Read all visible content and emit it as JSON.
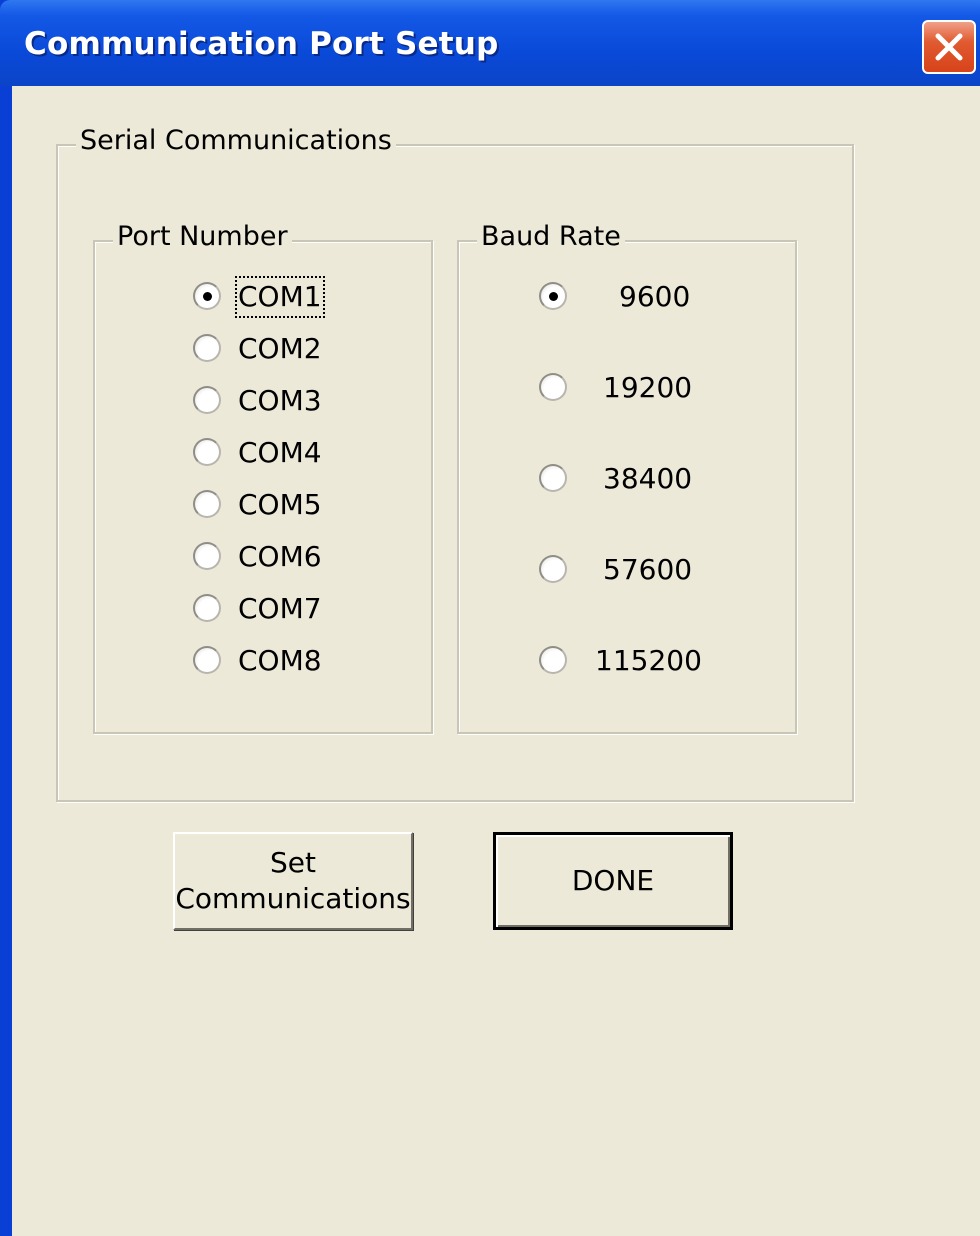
{
  "window": {
    "title": "Communication Port Setup"
  },
  "serial_group": {
    "label": "Serial Communications"
  },
  "port_group": {
    "label": "Port Number",
    "options": [
      "COM1",
      "COM2",
      "COM3",
      "COM4",
      "COM5",
      "COM6",
      "COM7",
      "COM8"
    ],
    "selected": "COM1"
  },
  "baud_group": {
    "label": "Baud Rate",
    "options": [
      "9600",
      "19200",
      "38400",
      "57600",
      "115200"
    ],
    "selected": "9600"
  },
  "buttons": {
    "set_line1": "Set",
    "set_line2": "Communications",
    "done": "DONE"
  },
  "colors": {
    "titlebar": "#0a4ad9",
    "client_bg": "#ece9d8",
    "close_button": "#d8431a"
  },
  "icons": {
    "close": "close-icon",
    "radio": "radio-button"
  }
}
